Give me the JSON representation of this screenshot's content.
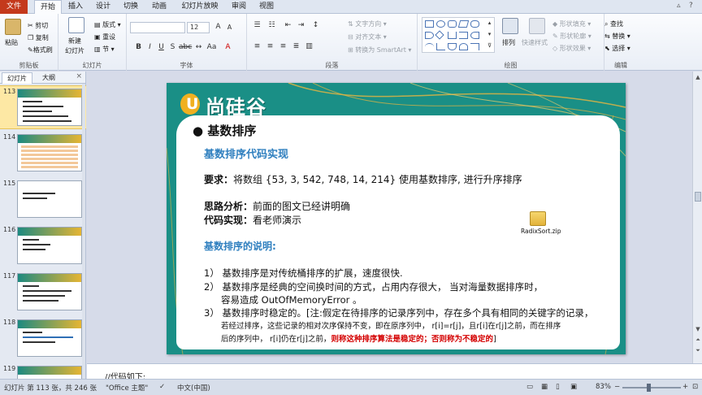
{
  "tabs": [
    "文件",
    "开始",
    "插入",
    "设计",
    "切换",
    "动画",
    "幻灯片放映",
    "审阅",
    "视图"
  ],
  "ribbon": {
    "clipboard": {
      "paste": "粘贴",
      "cut": "剪切",
      "copy": "复制",
      "format_painter": "格式刷",
      "label": "剪贴板"
    },
    "slides": {
      "new_slide": "新建",
      "new_slide2": "幻灯片",
      "layout": "版式",
      "reset": "重设",
      "section": "节",
      "label": "幻灯片"
    },
    "font": {
      "size": "12",
      "label": "字体"
    },
    "paragraph": {
      "text_direction": "文字方向",
      "align_text": "对齐文本",
      "smartart": "转换为 SmartArt",
      "label": "段落"
    },
    "drawing": {
      "arrange": "排列",
      "quick_styles": "快速样式",
      "shape_fill": "形状填充",
      "shape_outline": "形状轮廓",
      "shape_effects": "形状效果",
      "label": "绘图"
    },
    "editing": {
      "find": "查找",
      "replace": "替换",
      "select": "选择",
      "label": "编辑"
    }
  },
  "panel": {
    "tab_slides": "幻灯片",
    "tab_outline": "大纲",
    "thumbnails": [
      "113",
      "114",
      "115",
      "116",
      "117",
      "118",
      "119"
    ]
  },
  "slide": {
    "logo": "尚硅谷",
    "bullet_title": "基数排序",
    "heading": "基数排序代码实现",
    "req_label": "要求：",
    "req_text": "将数组 {53, 3, 542, 748, 14, 214} 使用基数排序, 进行升序排序",
    "analysis_label": "思路分析：",
    "analysis_text": "前面的图文已经讲明确",
    "code_label": "代码实现：",
    "code_text": "看老师演示",
    "heading2": "基数排序的说明:",
    "item1": "1）  基数排序是对传统桶排序的扩展，速度很快.",
    "item2": "2）  基数排序是经典的空间换时间的方式，占用内存很大，  当对海量数据排序时，",
    "item2b": "容易造成  OutOfMemoryError 。",
    "item3": "3）  基数排序时稳定的。[注:假定在待排序的记录序列中，存在多个具有相同的关键字的记录，",
    "note1": "若经过排序，这些记录的相对次序保持不变，即在原序列中，  r[i]=r[j]，且r[i]在r[j]之前，而在排序",
    "note2_pre": "后的序列中，  r[i]仍在r[j]之前，",
    "note2_red": "则称这种排序算法是稳定的；否则称为不稳定的",
    "note2_end": "]",
    "attachment": "RadixSort.zip"
  },
  "notes": {
    "text": "//代码如下:"
  },
  "status": {
    "slide_info": "幻灯片 第 113 张，共 246 张",
    "theme": "\"Office 主题\"",
    "language": "中文(中国)",
    "zoom": "83%"
  }
}
